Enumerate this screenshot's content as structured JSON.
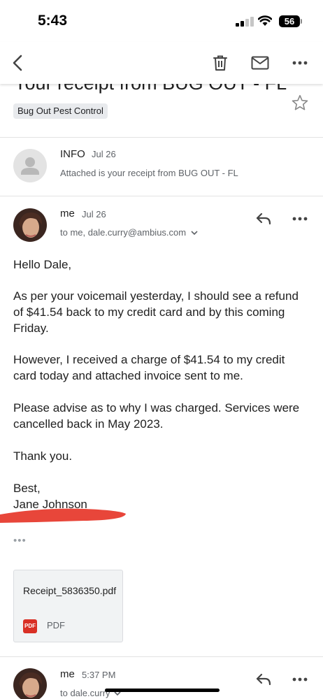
{
  "status_bar": {
    "time": "5:43",
    "battery": "56"
  },
  "toolbar": {
    "back": "back-arrow-icon",
    "delete": "trash-icon",
    "mark_unread": "envelope-icon",
    "more": "more-horizontal-icon"
  },
  "email": {
    "subject": "Your receipt from BUG OUT - FL",
    "label": "Bug Out Pest Control"
  },
  "messages": [
    {
      "sender": "INFO",
      "date": "Jul 26",
      "snippet": "Attached is your receipt from BUG OUT - FL"
    },
    {
      "sender": "me",
      "date": "Jul 26",
      "recipients": "to me, dale.curry@ambius.com",
      "greeting": "Hello Dale,",
      "paragraph1": "As per your voicemail yesterday, I should see a refund of $41.54 back to my credit card and by this coming Friday.",
      "paragraph2": "However, I received a charge of $41.54 to my credit card today and attached invoice sent to me.",
      "paragraph3": "Please advise as to why I was charged. Services were cancelled back in May 2023.",
      "thanks": "Thank you.",
      "signoff": "Best,",
      "signature": "Jane Johnson",
      "ellipsis": "•••",
      "attachment": {
        "name": "Receipt_5836350.pdf",
        "type": "PDF",
        "badge": "PDF"
      }
    },
    {
      "sender": "me",
      "date": "5:37 PM",
      "recipients": "to dale.curry"
    }
  ],
  "colors": {
    "redaction": "#e8463a",
    "pdf_red": "#d93025",
    "secondary_text": "#5f6368"
  }
}
